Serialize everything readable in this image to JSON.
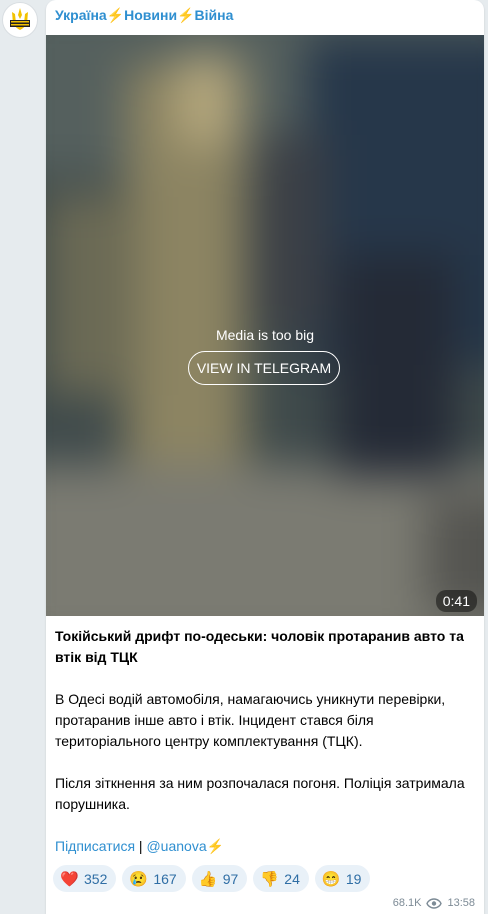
{
  "channel": {
    "name": "Україна⚡️Новини⚡️Війна",
    "avatar_icon": "trident-icon"
  },
  "media": {
    "message": "Media is too big",
    "button_label": "VIEW IN TELEGRAM",
    "duration": "0:41"
  },
  "post": {
    "title": "Токійський дрифт по-одеськи: чоловік протаранив авто та втік від ТЦК",
    "paragraph1": "В Одесі водій автомобіля, намагаючись уникнути перевірки, протаранив інше авто і втік. Інцидент стався біля територіального центру комплектування (ТЦК).",
    "paragraph2": "Після зіткнення за ним розпочалася погоня. Поліція затримала порушника.",
    "subscribe_label": "Підписатися",
    "separator": " | ",
    "channel_link": "@uanova⚡️"
  },
  "reactions": [
    {
      "emoji": "❤️",
      "count": "352"
    },
    {
      "emoji": "😢",
      "count": "167"
    },
    {
      "emoji": "👍",
      "count": "97"
    },
    {
      "emoji": "👎",
      "count": "24"
    },
    {
      "emoji": "😁",
      "count": "19"
    }
  ],
  "meta": {
    "views": "68.1K",
    "time": "13:58"
  },
  "colors": {
    "accent": "#2f8fd0",
    "background": "#e6ebee",
    "reaction_bg": "#e9f1f8"
  }
}
